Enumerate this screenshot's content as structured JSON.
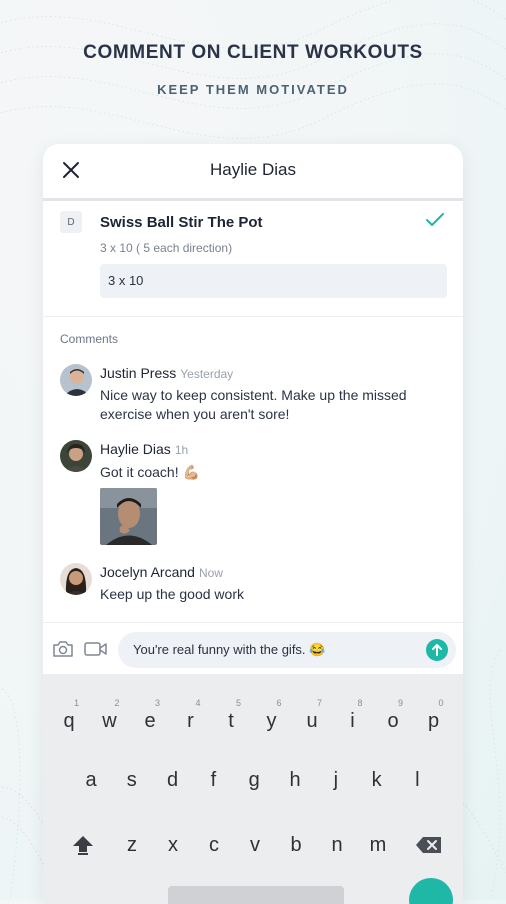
{
  "hero": {
    "title": "COMMENT ON CLIENT WORKOUTS",
    "subtitle": "KEEP THEM MOTIVATED"
  },
  "header": {
    "title": "Haylie Dias"
  },
  "exercise": {
    "badge": "D",
    "title": "Swiss Ball Stir The Pot",
    "detail": "3 x 10 ( 5 each direction)",
    "input_value": "3 x 10"
  },
  "comments_label": "Comments",
  "comments": [
    {
      "name": "Justin Press",
      "time": "Yesterday",
      "text": "Nice way to keep consistent. Make up the missed exercise when you aren't sore!"
    },
    {
      "name": "Haylie Dias",
      "time": "1h",
      "text": "Got it coach! 💪🏼"
    },
    {
      "name": "Jocelyn Arcand",
      "time": "Now",
      "text": "Keep up the good work"
    }
  ],
  "composer": {
    "value": "You're real funny with the gifs. 😂"
  },
  "keyboard": {
    "row1": [
      "q",
      "w",
      "e",
      "r",
      "t",
      "y",
      "u",
      "i",
      "o",
      "p"
    ],
    "row1_numbers": [
      "1",
      "2",
      "3",
      "4",
      "5",
      "6",
      "7",
      "8",
      "9",
      "0"
    ],
    "row2": [
      "a",
      "s",
      "d",
      "f",
      "g",
      "h",
      "j",
      "k",
      "l"
    ],
    "row3": [
      "z",
      "x",
      "c",
      "v",
      "b",
      "n",
      "m"
    ]
  },
  "colors": {
    "accent": "#1fb8a6",
    "text": "#1d2433",
    "muted": "#7a8190"
  }
}
